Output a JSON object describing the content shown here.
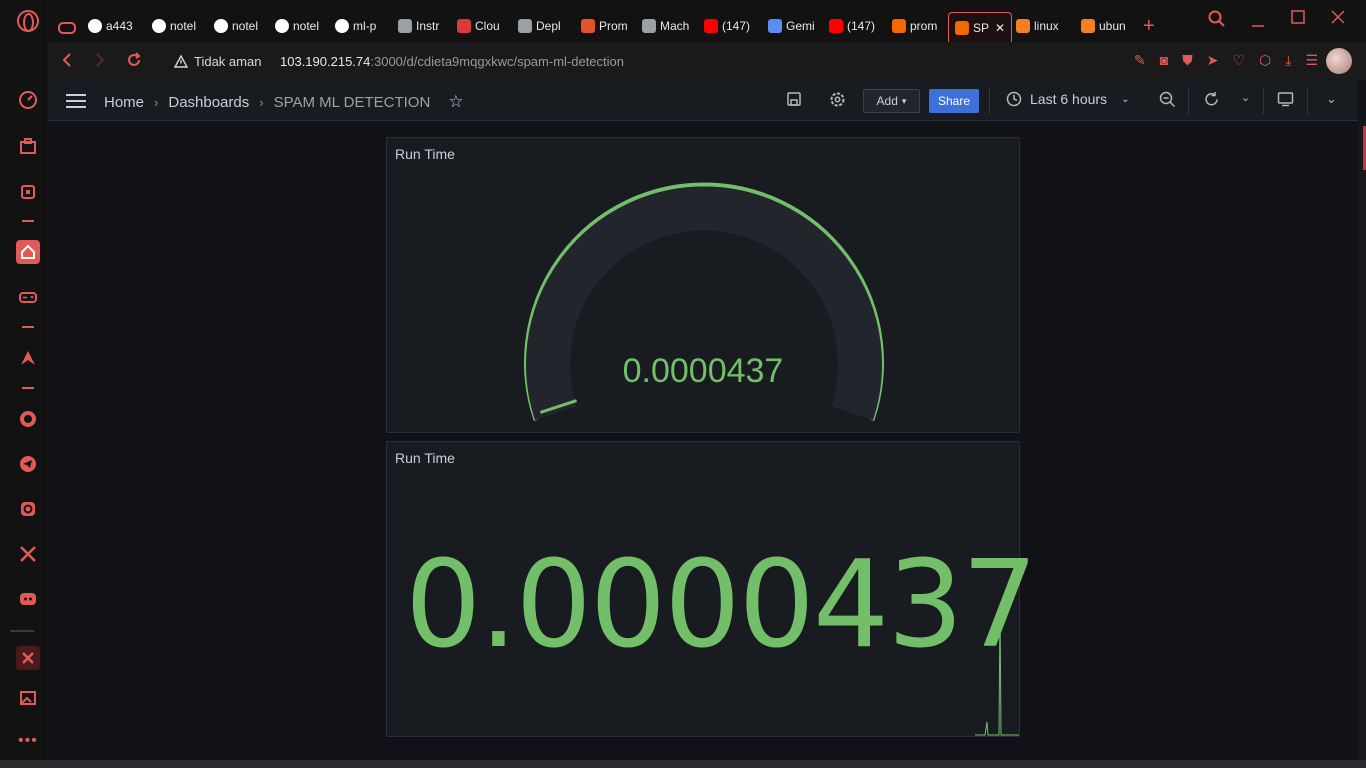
{
  "browser": {
    "tabs": [
      {
        "label": "a443",
        "icon": "github-icon"
      },
      {
        "label": "notel",
        "icon": "globe-icon"
      },
      {
        "label": "notel",
        "icon": "globe-icon"
      },
      {
        "label": "notel",
        "icon": "globe-icon"
      },
      {
        "label": "ml-p",
        "icon": "github-icon"
      },
      {
        "label": "Instr",
        "icon": "g-icon"
      },
      {
        "label": "Clou",
        "icon": "k-icon"
      },
      {
        "label": "Depl",
        "icon": "g-icon"
      },
      {
        "label": "Prom",
        "icon": "prometheus-icon"
      },
      {
        "label": "Mach",
        "icon": "g-icon"
      },
      {
        "label": "(147)",
        "icon": "youtube-icon"
      },
      {
        "label": "Gemi",
        "icon": "gemini-icon"
      },
      {
        "label": "(147)",
        "icon": "youtube-icon"
      },
      {
        "label": "prom",
        "icon": "grafana-icon"
      },
      {
        "label": "SP",
        "icon": "grafana-icon",
        "active": true
      },
      {
        "label": "linux",
        "icon": "stackoverflow-icon"
      },
      {
        "label": "ubun",
        "icon": "stackoverflow-icon"
      }
    ],
    "security_label": "Tidak aman",
    "url_host": "103.190.215.74",
    "url_path": ":3000/d/cdieta9mqgxkwc/spam-ml-detection"
  },
  "grafana": {
    "breadcrumbs": [
      "Home",
      "Dashboards",
      "SPAM ML DETECTION"
    ],
    "add_label": "Add",
    "share_label": "Share",
    "time_range": "Last 6 hours"
  },
  "panels": {
    "gauge": {
      "title": "Run Time",
      "value": "0.0000437",
      "color": "#73bf69"
    },
    "stat": {
      "title": "Run Time",
      "value": "0.0000437",
      "color": "#73bf69"
    }
  },
  "colors": {
    "accent": "#e25a57",
    "grafana_green": "#73bf69",
    "share_blue": "#3d71d9"
  }
}
